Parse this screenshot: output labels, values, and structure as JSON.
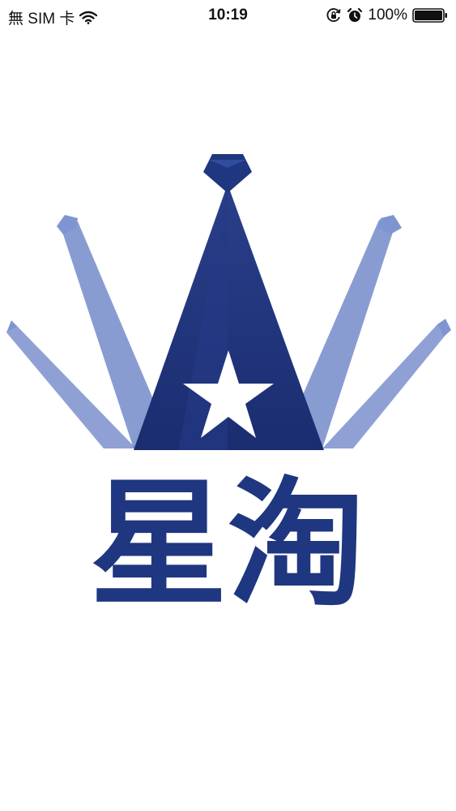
{
  "status_bar": {
    "carrier": "無 SIM 卡",
    "time": "10:19",
    "battery_percent": "100%",
    "battery_level": 1.0,
    "icons": [
      "wifi-icon",
      "orientation-lock-icon",
      "alarm-icon",
      "battery-icon"
    ]
  },
  "splash": {
    "logo_text": "星淘",
    "logo_icons": [
      "crown-icon",
      "star-icon",
      "spotlight-icon"
    ]
  },
  "colors": {
    "logo_navy": "#1f3680",
    "logo_light_blue": "#6f86c8",
    "background": "#ffffff"
  }
}
